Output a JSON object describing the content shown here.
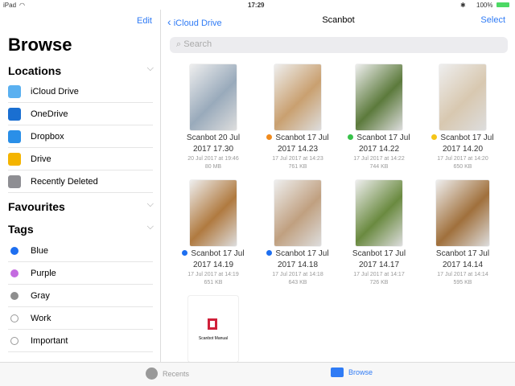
{
  "status": {
    "device": "iPad",
    "time": "17:29",
    "battery": "100%"
  },
  "sidebar": {
    "edit": "Edit",
    "title": "Browse",
    "locations_header": "Locations",
    "locations": [
      {
        "label": "iCloud Drive",
        "color": "#5ab0f0"
      },
      {
        "label": "OneDrive",
        "color": "#1a6fd1"
      },
      {
        "label": "Dropbox",
        "color": "#2a8fe8"
      },
      {
        "label": "Drive",
        "color": "#f4b400"
      },
      {
        "label": "Recently Deleted",
        "color": "#8e8e93"
      }
    ],
    "favourites_header": "Favourites",
    "tags_header": "Tags",
    "tags": [
      {
        "label": "Blue",
        "color": "#1e6ff0"
      },
      {
        "label": "Purple",
        "color": "#c46be0"
      },
      {
        "label": "Gray",
        "color": "#8e8e8e"
      },
      {
        "label": "Work",
        "color": ""
      },
      {
        "label": "Important",
        "color": ""
      }
    ]
  },
  "nav": {
    "back": "iCloud Drive",
    "title": "Scanbot",
    "select": "Select"
  },
  "search": {
    "placeholder": "Search"
  },
  "files": [
    {
      "name1": "Scanbot 20 Jul",
      "name2": "2017 17.30",
      "date": "20 Jul 2017 at 19:46",
      "size": "80 MB",
      "tag": "",
      "thumb": "#9ab"
    },
    {
      "name1": "Scanbot 17 Jul",
      "name2": "2017 14.23",
      "date": "17 Jul 2017 at 14:23",
      "size": "761 KB",
      "tag": "#f08a1c",
      "thumb": "#c9a070"
    },
    {
      "name1": "Scanbot 17 Jul",
      "name2": "2017 14.22",
      "date": "17 Jul 2017 at 14:22",
      "size": "744 KB",
      "tag": "#38c24a",
      "thumb": "#5c7a3c"
    },
    {
      "name1": "Scanbot 17 Jul",
      "name2": "2017 14.20",
      "date": "17 Jul 2017 at 14:20",
      "size": "650 KB",
      "tag": "#f5c518",
      "thumb": "#d8c8b0"
    },
    {
      "name1": "Scanbot 17 Jul",
      "name2": "2017 14.19",
      "date": "17 Jul 2017 at 14:19",
      "size": "651 KB",
      "tag": "#1e6ff0",
      "thumb": "#b07a40"
    },
    {
      "name1": "Scanbot 17 Jul",
      "name2": "2017 14.18",
      "date": "17 Jul 2017 at 14:18",
      "size": "643 KB",
      "tag": "#1e6ff0",
      "thumb": "#c0a080"
    },
    {
      "name1": "Scanbot 17 Jul",
      "name2": "2017 14.17",
      "date": "17 Jul 2017 at 14:17",
      "size": "726 KB",
      "tag": "",
      "thumb": "#6a8a40"
    },
    {
      "name1": "Scanbot 17 Jul",
      "name2": "2017 14.14",
      "date": "17 Jul 2017 at 14:14",
      "size": "595 KB",
      "tag": "",
      "thumb": "#a0703c"
    }
  ],
  "manual": {
    "label": "Scanbot Manual"
  },
  "tabs": {
    "recents": "Recents",
    "browse": "Browse"
  }
}
